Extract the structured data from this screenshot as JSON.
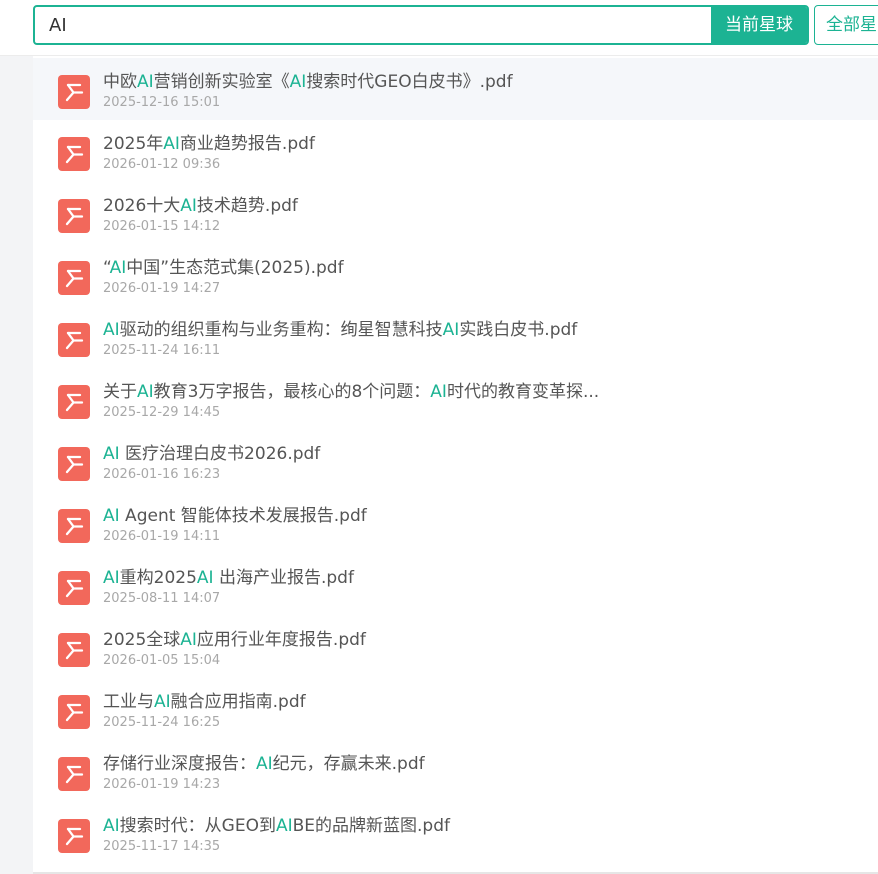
{
  "search": {
    "value": "AI",
    "highlight_term": "AI"
  },
  "buttons": {
    "current_planet": "当前星球",
    "all_planets": "全部星"
  },
  "colors": {
    "accent": "#1cb393",
    "pdf_icon": "#f2685b",
    "title_text": "#555555",
    "date_text": "#a8a8a8"
  },
  "results": [
    {
      "title": "中欧AI营销创新实验室《AI搜索时代GEO白皮书》.pdf",
      "date": "2025-12-16 15:01",
      "icon": "pdf-icon"
    },
    {
      "title": "2025年AI商业趋势报告.pdf",
      "date": "2026-01-12 09:36",
      "icon": "pdf-icon"
    },
    {
      "title": "2026十大AI技术趋势.pdf",
      "date": "2026-01-15 14:12",
      "icon": "pdf-icon"
    },
    {
      "title": "“AI中国”生态范式集(2025).pdf",
      "date": "2026-01-19 14:27",
      "icon": "pdf-icon"
    },
    {
      "title": "AI驱动的组织重构与业务重构：绚星智慧科技AI实践白皮书.pdf",
      "date": "2025-11-24 16:11",
      "icon": "pdf-icon"
    },
    {
      "title": "关于AI教育3万字报告，最核心的8个问题：AI时代的教育变革探...",
      "date": "2025-12-29 14:45",
      "icon": "pdf-icon"
    },
    {
      "title": "AI 医疗治理白皮书2026.pdf",
      "date": "2026-01-16 16:23",
      "icon": "pdf-icon"
    },
    {
      "title": "AI Agent 智能体技术发展报告.pdf",
      "date": "2026-01-19 14:11",
      "icon": "pdf-icon"
    },
    {
      "title": "AI重构2025AI 出海产业报告.pdf",
      "date": "2025-08-11 14:07",
      "icon": "pdf-icon"
    },
    {
      "title": "2025全球AI应用行业年度报告.pdf",
      "date": "2026-01-05 15:04",
      "icon": "pdf-icon"
    },
    {
      "title": "工业与AI融合应用指南.pdf",
      "date": "2025-11-24 16:25",
      "icon": "pdf-icon"
    },
    {
      "title": "存储行业深度报告：AI纪元，存赢未来.pdf",
      "date": "2026-01-19 14:23",
      "icon": "pdf-icon"
    },
    {
      "title": "AI搜索时代：从GEO到AIBE的品牌新蓝图.pdf",
      "date": "2025-11-17 14:35",
      "icon": "pdf-icon"
    }
  ]
}
